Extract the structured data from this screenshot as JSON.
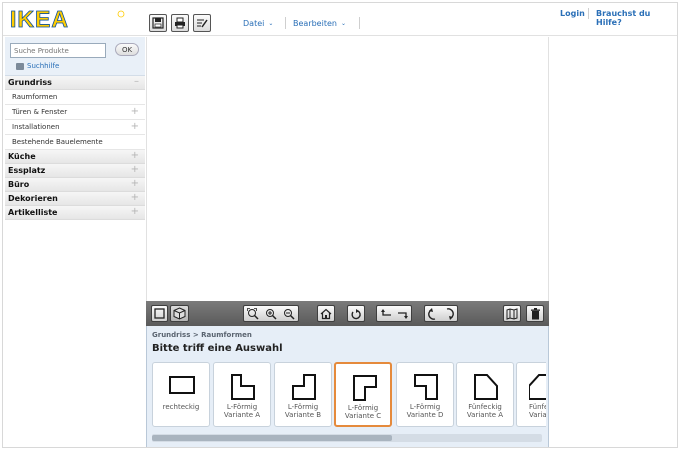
{
  "header": {
    "logo_text": "IKEA",
    "menu": [
      {
        "label": "Datei"
      },
      {
        "label": "Bearbeiten"
      }
    ],
    "links": {
      "login": "Login",
      "help": "Brauchst du Hilfe?"
    },
    "toolbar_icons": [
      "save-icon",
      "print-icon",
      "edit-list-icon"
    ]
  },
  "sidebar": {
    "search": {
      "placeholder": "Suche Produkte",
      "ok": "OK",
      "help": "Suchhilfe"
    },
    "categories": [
      {
        "label": "Grundriss",
        "sign": "–",
        "expanded": true,
        "items": [
          {
            "label": "Raumformen",
            "sign": ""
          },
          {
            "label": "Türen & Fenster",
            "sign": "+"
          },
          {
            "label": "Installationen",
            "sign": "+"
          },
          {
            "label": "Bestehende Bauelemente",
            "sign": ""
          }
        ]
      },
      {
        "label": "Küche",
        "sign": "+"
      },
      {
        "label": "Essplatz",
        "sign": "+"
      },
      {
        "label": "Büro",
        "sign": "+"
      },
      {
        "label": "Dekorieren",
        "sign": "+"
      },
      {
        "label": "Artikelliste",
        "sign": "+"
      }
    ]
  },
  "toolbar": {
    "icons": [
      "view-2d-icon",
      "view-3d-icon",
      "zoom-fit-icon",
      "zoom-in-icon",
      "zoom-out-icon",
      "home-icon",
      "undo-icon",
      "rotate-left-icon",
      "rotate-right-icon",
      "rotate-ccw-icon",
      "rotate-cw-icon",
      "catalog-icon",
      "trash-icon"
    ]
  },
  "bottom": {
    "breadcrumb": {
      "root": "Grundriss",
      "separator": ">",
      "current": "Raumformen"
    },
    "prompt": "Bitte triff eine Auswahl",
    "shapes": [
      {
        "label_line1": "rechteckig",
        "label_line2": "",
        "shape": "rect",
        "selected": false
      },
      {
        "label_line1": "L-Förmig",
        "label_line2": "Variante A",
        "shape": "l-a",
        "selected": false
      },
      {
        "label_line1": "L-Förmig",
        "label_line2": "Variante B",
        "shape": "l-b",
        "selected": false
      },
      {
        "label_line1": "L-Förmig",
        "label_line2": "Variante C",
        "shape": "l-c",
        "selected": true
      },
      {
        "label_line1": "L-Förmig",
        "label_line2": "Variante D",
        "shape": "l-d",
        "selected": false
      },
      {
        "label_line1": "Fünfeckig",
        "label_line2": "Variante A",
        "shape": "pent-a",
        "selected": false
      },
      {
        "label_line1": "Fünfeckig",
        "label_line2": "Varian",
        "shape": "pent-b",
        "selected": false
      }
    ]
  },
  "colors": {
    "link": "#2a6fb7",
    "selected_border": "#e58a3c",
    "logo_blue": "#0a4f9e",
    "logo_yellow": "#ffcc00"
  }
}
